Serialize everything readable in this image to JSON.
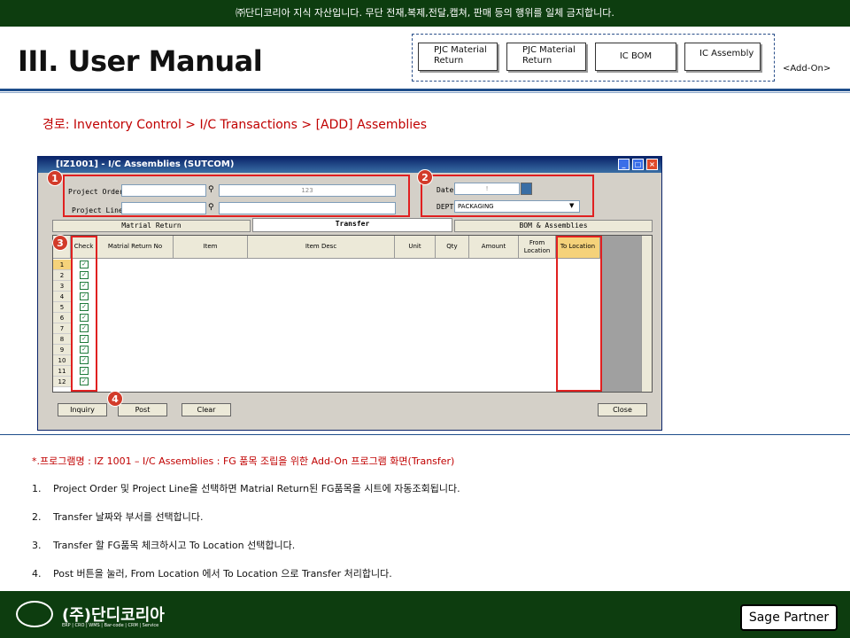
{
  "banner": "㈜단디코리아 지식 자산입니다. 무단 전재,복제,전달,캡쳐, 판매 등의 행위를 일체 금지합니다.",
  "title": "III. User Manual",
  "modules": [
    "PJC Material Return",
    "PJC Material Return",
    "IC BOM",
    "IC Assembly"
  ],
  "addon": "<Add-On>",
  "path": "경로: Inventory Control > I/C Transactions > [ADD] Assemblies",
  "window": {
    "title": "[IZ1001] - I/C Assemblies (SUTCOM)",
    "project_order_label": "Project Order",
    "project_line_label": "Project Line",
    "order_value": "123",
    "date_label": "Date",
    "date_value": "!",
    "dept_label": "DEPT",
    "dept_value": "PACKAGING",
    "tabs": [
      "Matrial Return",
      "Transfer",
      "BOM & Assemblies"
    ],
    "columns": [
      "Check",
      "Matrial Return No",
      "Item",
      "Item Desc",
      "Unit",
      "Qty",
      "Amount",
      "From Location",
      "To Location"
    ],
    "rows": [
      "1",
      "2",
      "3",
      "4",
      "5",
      "6",
      "7",
      "8",
      "9",
      "10",
      "11",
      "12"
    ],
    "buttons": {
      "inquiry": "Inquiry",
      "post": "Post",
      "clear": "Clear",
      "close": "Close"
    },
    "badges": [
      "1",
      "2",
      "3",
      "4"
    ]
  },
  "notes": {
    "title": "*.프로그램명 : IZ 1001 – I/C Assemblies : FG 품목 조립을 위한 Add-On 프로그램 화면(Transfer)",
    "steps": [
      {
        "n": "1.",
        "text": "Project Order 및 Project Line을 선택하면 Matrial Return된 FG품목을 시트에 자동조회됩니다."
      },
      {
        "n": "2.",
        "text": "Transfer 날짜와 부서를 선택합니다."
      },
      {
        "n": "3.",
        "text": "Transfer 할 FG품목 체크하시고 To Location 선택합니다."
      },
      {
        "n": "4.",
        "text": "Post 버튼을 눌러, From Location 에서 To Location 으로 Transfer 처리합니다."
      }
    ]
  },
  "footer": {
    "logo": "(주)단디코리아",
    "logo_sub": "ERP | CRO | WMS | Bar-code | CRM | Service",
    "partner": "Sage Partner"
  },
  "colors": {
    "banner": "#0d3d0f",
    "accent_red": "#c00000",
    "rule_blue": "#1f4e8c"
  }
}
